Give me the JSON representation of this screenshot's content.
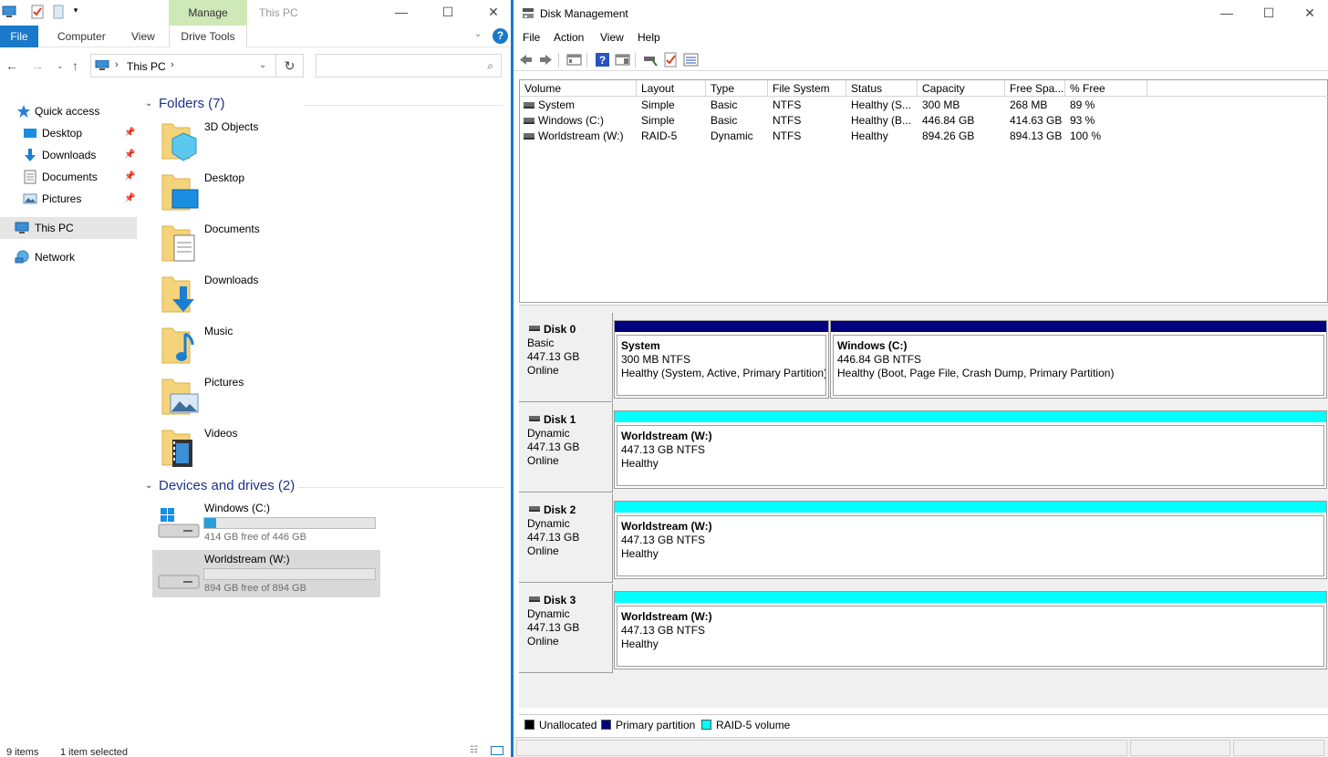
{
  "explorer": {
    "window_title": "This PC",
    "manage_tab": "Manage",
    "ribbon_tabs": {
      "file": "File",
      "computer": "Computer",
      "view": "View",
      "drive_tools": "Drive Tools"
    },
    "help_label": "?",
    "address": {
      "location": "This PC",
      "separator": "›"
    },
    "search": {
      "placeholder": ""
    },
    "nav_pane": {
      "quick_access": "Quick access",
      "items": [
        {
          "label": "Desktop",
          "icon": "desktop-icon",
          "pinned": true
        },
        {
          "label": "Downloads",
          "icon": "downloads-icon",
          "pinned": true
        },
        {
          "label": "Documents",
          "icon": "documents-icon",
          "pinned": true
        },
        {
          "label": "Pictures",
          "icon": "pictures-icon",
          "pinned": true
        }
      ],
      "this_pc": "This PC",
      "network": "Network"
    },
    "folders_header": "Folders (7)",
    "folders": [
      {
        "label": "3D Objects",
        "icon": "3d-objects-folder-icon"
      },
      {
        "label": "Desktop",
        "icon": "desktop-folder-icon"
      },
      {
        "label": "Documents",
        "icon": "documents-folder-icon"
      },
      {
        "label": "Downloads",
        "icon": "downloads-folder-icon"
      },
      {
        "label": "Music",
        "icon": "music-folder-icon"
      },
      {
        "label": "Pictures",
        "icon": "pictures-folder-icon"
      },
      {
        "label": "Videos",
        "icon": "videos-folder-icon"
      }
    ],
    "devices_header": "Devices and drives (2)",
    "drives": [
      {
        "name": "Windows (C:)",
        "free_text": "414 GB free of 446 GB",
        "used_fraction": 0.07,
        "selected": false
      },
      {
        "name": "Worldstream (W:)",
        "free_text": "894 GB free of 894 GB",
        "used_fraction": 0.0,
        "selected": true
      }
    ],
    "status": {
      "items": "9 items",
      "selected": "1 item selected"
    }
  },
  "diskmgmt": {
    "title": "Disk Management",
    "menu": {
      "file": "File",
      "action": "Action",
      "view": "View",
      "help": "Help"
    },
    "columns": [
      "Volume",
      "Layout",
      "Type",
      "File System",
      "Status",
      "Capacity",
      "Free Spa...",
      "% Free"
    ],
    "volumes": [
      {
        "volume": "System",
        "layout": "Simple",
        "type": "Basic",
        "fs": "NTFS",
        "status": "Healthy (S...",
        "capacity": "300 MB",
        "free": "268 MB",
        "pct": "89 %"
      },
      {
        "volume": "Windows (C:)",
        "layout": "Simple",
        "type": "Basic",
        "fs": "NTFS",
        "status": "Healthy (B...",
        "capacity": "446.84 GB",
        "free": "414.63 GB",
        "pct": "93 %"
      },
      {
        "volume": "Worldstream (W:)",
        "layout": "RAID-5",
        "type": "Dynamic",
        "fs": "NTFS",
        "status": "Healthy",
        "capacity": "894.26 GB",
        "free": "894.13 GB",
        "pct": "100 %"
      }
    ],
    "disks": [
      {
        "name": "Disk 0",
        "type": "Basic",
        "size": "447.13 GB",
        "state": "Online",
        "partitions": [
          {
            "name": "System",
            "size": "300 MB NTFS",
            "status": "Healthy (System, Active, Primary Partition)",
            "kind": "primary"
          },
          {
            "name": "Windows  (C:)",
            "size": "446.84 GB NTFS",
            "status": "Healthy (Boot, Page File, Crash Dump, Primary Partition)",
            "kind": "primary"
          }
        ]
      },
      {
        "name": "Disk 1",
        "type": "Dynamic",
        "size": "447.13 GB",
        "state": "Online",
        "partitions": [
          {
            "name": "Worldstream  (W:)",
            "size": "447.13 GB NTFS",
            "status": "Healthy",
            "kind": "raid5"
          }
        ]
      },
      {
        "name": "Disk 2",
        "type": "Dynamic",
        "size": "447.13 GB",
        "state": "Online",
        "partitions": [
          {
            "name": "Worldstream  (W:)",
            "size": "447.13 GB NTFS",
            "status": "Healthy",
            "kind": "raid5"
          }
        ]
      },
      {
        "name": "Disk 3",
        "type": "Dynamic",
        "size": "447.13 GB",
        "state": "Online",
        "partitions": [
          {
            "name": "Worldstream  (W:)",
            "size": "447.13 GB NTFS",
            "status": "Healthy",
            "kind": "raid5"
          }
        ]
      }
    ],
    "legend": [
      {
        "label": "Unallocated",
        "color": "#000000"
      },
      {
        "label": "Primary partition",
        "color": "#000080"
      },
      {
        "label": "RAID-5 volume",
        "color": "#00ffff"
      }
    ],
    "colors": {
      "primary": "#000080",
      "raid5": "#00ffff",
      "accent": "#1979ca"
    }
  }
}
